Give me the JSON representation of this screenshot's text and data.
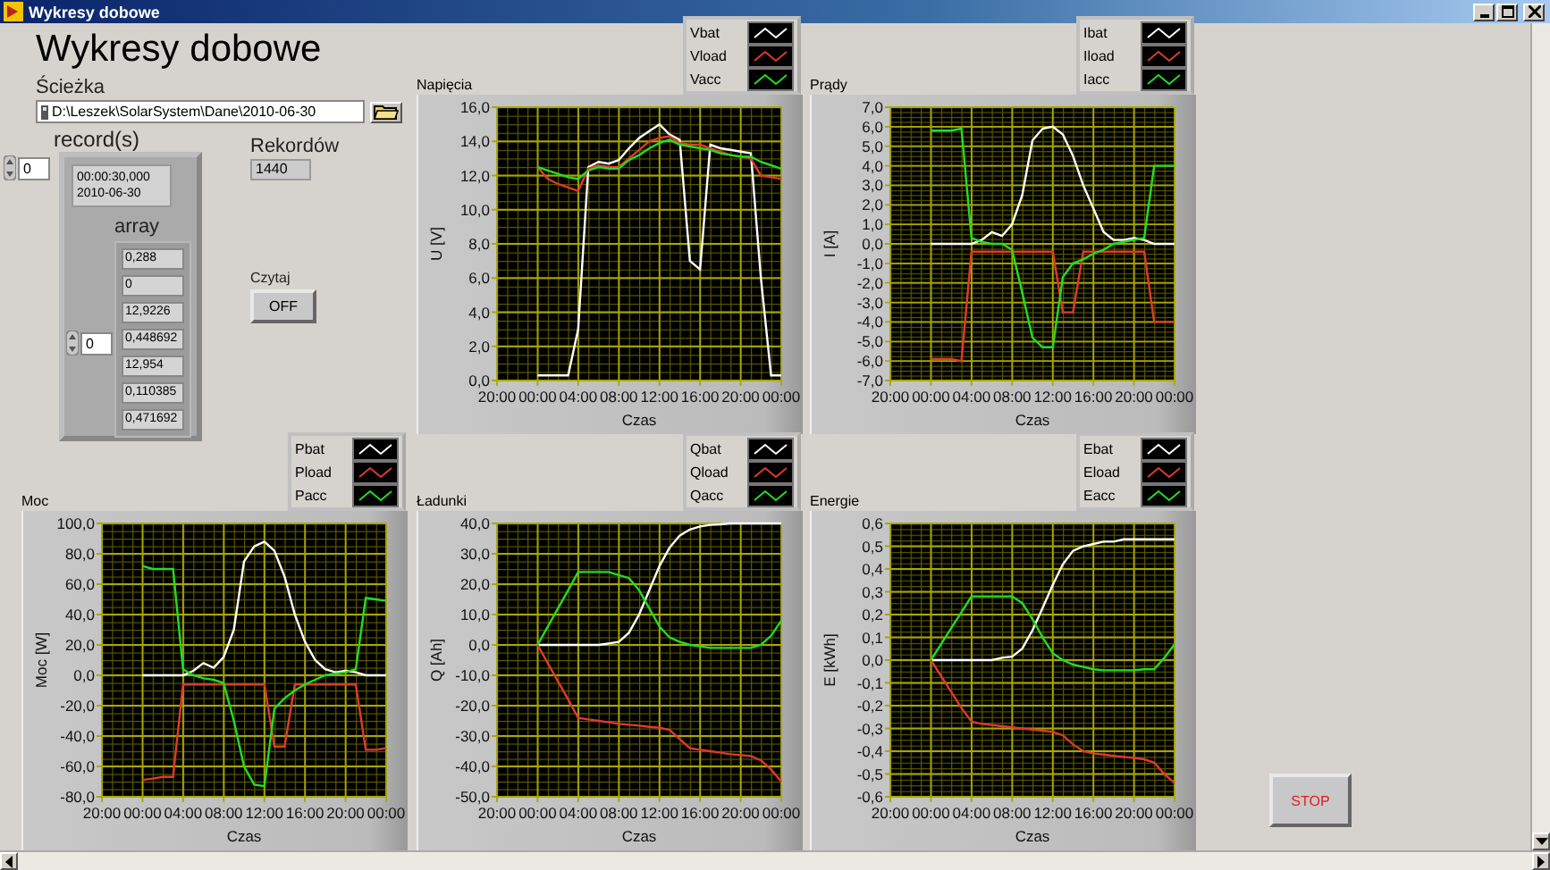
{
  "window": {
    "title": "Wykresy dobowe"
  },
  "heading": "Wykresy dobowe",
  "path": {
    "label": "Ścieżka",
    "value": "D:\\Leszek\\SolarSystem\\Dane\\2010-06-30"
  },
  "records": {
    "label": "record(s)",
    "index": "0",
    "time": "00:00:30,000",
    "date": "2010-06-30",
    "array_label": "array",
    "array_index": "0",
    "values": [
      "0,288",
      "0",
      "12,9226",
      "0,448692",
      "12,954",
      "0,110385",
      "0,471692"
    ]
  },
  "count": {
    "label": "Rekordów",
    "value": "1440"
  },
  "read_button": {
    "label": "Czytaj",
    "text": "OFF"
  },
  "charts": [
    {
      "title": "Napięcia",
      "chart_data": {
        "type": "line",
        "grid": true,
        "xlabel": "Czas",
        "ylabel": "U [V]",
        "x": [
          "2010-06-30T00:00",
          "2010-06-30T01:00",
          "2010-06-30T02:00",
          "2010-06-30T03:00",
          "2010-06-30T04:00",
          "2010-06-30T05:00",
          "2010-06-30T06:00",
          "2010-06-30T07:00",
          "2010-06-30T08:00",
          "2010-06-30T09:00",
          "2010-06-30T10:00",
          "2010-06-30T11:00",
          "2010-06-30T12:00",
          "2010-06-30T13:00",
          "2010-06-30T14:00",
          "2010-06-30T15:00",
          "2010-06-30T16:00",
          "2010-06-30T17:00",
          "2010-06-30T18:00",
          "2010-06-30T19:00",
          "2010-06-30T20:00",
          "2010-06-30T21:00",
          "2010-06-30T22:00",
          "2010-06-30T23:00",
          "2010-07-01T00:00"
        ],
        "xlim": [
          "2010-06-29T20:00",
          "2010-07-01T00:00"
        ],
        "ylim": [
          0,
          16
        ],
        "xticks": [
          {
            "value": "2010-06-29T20:00",
            "label": "20:00"
          },
          {
            "value": "2010-06-30T00:00",
            "label": "00:00"
          },
          {
            "value": "2010-06-30T04:00",
            "label": "04:00"
          },
          {
            "value": "2010-06-30T08:00",
            "label": "08:00"
          },
          {
            "value": "2010-06-30T12:00",
            "label": "12:00"
          },
          {
            "value": "2010-06-30T16:00",
            "label": "16:00"
          },
          {
            "value": "2010-06-30T20:00",
            "label": "20:00"
          },
          {
            "value": "2010-07-01T00:00",
            "label": "00:00"
          }
        ],
        "yticks": [
          {
            "value": 0,
            "label": "0,0"
          },
          {
            "value": 2,
            "label": "2,0"
          },
          {
            "value": 4,
            "label": "4,0"
          },
          {
            "value": 6,
            "label": "6,0"
          },
          {
            "value": 8,
            "label": "8,0"
          },
          {
            "value": 10,
            "label": "10,0"
          },
          {
            "value": 12,
            "label": "12,0"
          },
          {
            "value": 14,
            "label": "14,0"
          },
          {
            "value": 16,
            "label": "16,0"
          }
        ],
        "series": [
          {
            "name": "Vbat",
            "color": "#ffffff",
            "values": [
              0.3,
              0.3,
              0.3,
              0.3,
              3,
              12.5,
              12.8,
              12.7,
              12.9,
              13.6,
              14.2,
              14.6,
              15,
              14.4,
              14.1,
              7,
              6.5,
              13.8,
              13.6,
              13.5,
              13.4,
              13.3,
              6,
              0.3,
              0.3
            ]
          },
          {
            "name": "Vload",
            "color": "#e03a2a",
            "values": [
              12.5,
              11.8,
              11.5,
              11.3,
              11.1,
              12.4,
              12.6,
              12.5,
              12.5,
              13,
              13.5,
              14,
              14.2,
              14.3,
              13.9,
              13.8,
              13.8,
              13.6,
              13.4,
              13.2,
              13.1,
              13,
              12,
              11.9,
              11.8
            ]
          },
          {
            "name": "Vacc",
            "color": "#22dd22",
            "values": [
              12.5,
              12.3,
              12.1,
              11.9,
              11.8,
              12.3,
              12.5,
              12.4,
              12.4,
              12.9,
              13.2,
              13.6,
              13.9,
              14.1,
              13.8,
              13.7,
              13.6,
              13.5,
              13.3,
              13.2,
              13.1,
              13.1,
              12.8,
              12.6,
              12.4
            ]
          }
        ]
      }
    },
    {
      "title": "Prądy",
      "chart_data": {
        "type": "line",
        "grid": true,
        "xlabel": "Czas",
        "ylabel": "I [A]",
        "x": [
          "2010-06-30T00:00",
          "2010-06-30T01:00",
          "2010-06-30T02:00",
          "2010-06-30T03:00",
          "2010-06-30T04:00",
          "2010-06-30T05:00",
          "2010-06-30T06:00",
          "2010-06-30T07:00",
          "2010-06-30T08:00",
          "2010-06-30T09:00",
          "2010-06-30T10:00",
          "2010-06-30T11:00",
          "2010-06-30T12:00",
          "2010-06-30T13:00",
          "2010-06-30T14:00",
          "2010-06-30T15:00",
          "2010-06-30T16:00",
          "2010-06-30T17:00",
          "2010-06-30T18:00",
          "2010-06-30T19:00",
          "2010-06-30T20:00",
          "2010-06-30T21:00",
          "2010-06-30T22:00",
          "2010-06-30T23:00",
          "2010-07-01T00:00"
        ],
        "xlim": [
          "2010-06-29T20:00",
          "2010-07-01T00:00"
        ],
        "ylim": [
          -7,
          7
        ],
        "xticks": [
          {
            "value": "2010-06-29T20:00",
            "label": "20:00"
          },
          {
            "value": "2010-06-30T00:00",
            "label": "00:00"
          },
          {
            "value": "2010-06-30T04:00",
            "label": "04:00"
          },
          {
            "value": "2010-06-30T08:00",
            "label": "08:00"
          },
          {
            "value": "2010-06-30T12:00",
            "label": "12:00"
          },
          {
            "value": "2010-06-30T16:00",
            "label": "16:00"
          },
          {
            "value": "2010-06-30T20:00",
            "label": "20:00"
          },
          {
            "value": "2010-07-01T00:00",
            "label": "00:00"
          }
        ],
        "yticks": [
          {
            "value": -7,
            "label": "-7,0"
          },
          {
            "value": -6,
            "label": "-6,0"
          },
          {
            "value": -5,
            "label": "-5,0"
          },
          {
            "value": -4,
            "label": "-4,0"
          },
          {
            "value": -3,
            "label": "-3,0"
          },
          {
            "value": -2,
            "label": "-2,0"
          },
          {
            "value": -1,
            "label": "-1,0"
          },
          {
            "value": 0,
            "label": "0,0"
          },
          {
            "value": 1,
            "label": "1,0"
          },
          {
            "value": 2,
            "label": "2,0"
          },
          {
            "value": 3,
            "label": "3,0"
          },
          {
            "value": 4,
            "label": "4,0"
          },
          {
            "value": 5,
            "label": "5,0"
          },
          {
            "value": 6,
            "label": "6,0"
          },
          {
            "value": 7,
            "label": "7,0"
          }
        ],
        "series": [
          {
            "name": "Ibat",
            "color": "#ffffff",
            "values": [
              0,
              0,
              0,
              0,
              0,
              0.2,
              0.6,
              0.4,
              1,
              2.5,
              5.3,
              5.9,
              6,
              5.6,
              4.5,
              3,
              1.8,
              0.6,
              0.2,
              0.2,
              0.3,
              0.2,
              0,
              0,
              0
            ]
          },
          {
            "name": "Iload",
            "color": "#e03a2a",
            "values": [
              -5.9,
              -5.9,
              -5.9,
              -6,
              -0.4,
              -0.4,
              -0.4,
              -0.4,
              -0.4,
              -0.4,
              -0.4,
              -0.4,
              -0.4,
              -3.5,
              -3.5,
              -0.4,
              -0.4,
              -0.4,
              -0.4,
              -0.4,
              -0.4,
              -0.4,
              -4,
              -4,
              -4
            ]
          },
          {
            "name": "Iacc",
            "color": "#22dd22",
            "values": [
              5.8,
              5.8,
              5.8,
              5.9,
              0.3,
              0.1,
              0,
              0,
              -0.3,
              -2.5,
              -4.8,
              -5.3,
              -5.3,
              -1.7,
              -1,
              -0.8,
              -0.5,
              -0.3,
              0,
              0.1,
              0.2,
              0.3,
              4,
              4,
              4
            ]
          }
        ]
      }
    },
    {
      "title": "Moc",
      "chart_data": {
        "type": "line",
        "grid": true,
        "xlabel": "Czas",
        "ylabel": "Moc [W]",
        "x": [
          "2010-06-30T00:00",
          "2010-06-30T01:00",
          "2010-06-30T02:00",
          "2010-06-30T03:00",
          "2010-06-30T04:00",
          "2010-06-30T05:00",
          "2010-06-30T06:00",
          "2010-06-30T07:00",
          "2010-06-30T08:00",
          "2010-06-30T09:00",
          "2010-06-30T10:00",
          "2010-06-30T11:00",
          "2010-06-30T12:00",
          "2010-06-30T13:00",
          "2010-06-30T14:00",
          "2010-06-30T15:00",
          "2010-06-30T16:00",
          "2010-06-30T17:00",
          "2010-06-30T18:00",
          "2010-06-30T19:00",
          "2010-06-30T20:00",
          "2010-06-30T21:00",
          "2010-06-30T22:00",
          "2010-06-30T23:00",
          "2010-07-01T00:00"
        ],
        "xlim": [
          "2010-06-29T20:00",
          "2010-07-01T00:00"
        ],
        "ylim": [
          -80,
          100
        ],
        "xticks": [
          {
            "value": "2010-06-29T20:00",
            "label": "20:00"
          },
          {
            "value": "2010-06-30T00:00",
            "label": "00:00"
          },
          {
            "value": "2010-06-30T04:00",
            "label": "04:00"
          },
          {
            "value": "2010-06-30T08:00",
            "label": "08:00"
          },
          {
            "value": "2010-06-30T12:00",
            "label": "12:00"
          },
          {
            "value": "2010-06-30T16:00",
            "label": "16:00"
          },
          {
            "value": "2010-06-30T20:00",
            "label": "20:00"
          },
          {
            "value": "2010-07-01T00:00",
            "label": "00:00"
          }
        ],
        "yticks": [
          {
            "value": -80,
            "label": "-80,0"
          },
          {
            "value": -60,
            "label": "-60,0"
          },
          {
            "value": -40,
            "label": "-40,0"
          },
          {
            "value": -20,
            "label": "-20,0"
          },
          {
            "value": 0,
            "label": "0,0"
          },
          {
            "value": 20,
            "label": "20,0"
          },
          {
            "value": 40,
            "label": "40,0"
          },
          {
            "value": 60,
            "label": "60,0"
          },
          {
            "value": 80,
            "label": "80,0"
          },
          {
            "value": 100,
            "label": "100,0"
          }
        ],
        "series": [
          {
            "name": "Pbat",
            "color": "#ffffff",
            "values": [
              0,
              0,
              0,
              0,
              0,
              3,
              8,
              5,
              12,
              30,
              75,
              85,
              88,
              82,
              65,
              40,
              22,
              10,
              4,
              2,
              3,
              2,
              0,
              0,
              0
            ]
          },
          {
            "name": "Pload",
            "color": "#e03a2a",
            "values": [
              -69,
              -68,
              -67,
              -67,
              -6,
              -6,
              -6,
              -6,
              -6,
              -6,
              -6,
              -6,
              -6,
              -47,
              -47,
              -6,
              -6,
              -6,
              -6,
              -6,
              -6,
              -6,
              -49,
              -49,
              -48
            ]
          },
          {
            "name": "Pacc",
            "color": "#22dd22",
            "values": [
              72,
              70,
              70,
              70,
              4,
              0,
              -2,
              -3,
              -5,
              -30,
              -60,
              -72,
              -73,
              -22,
              -15,
              -10,
              -6,
              -3,
              0,
              1,
              2,
              4,
              51,
              50,
              49
            ]
          }
        ]
      }
    },
    {
      "title": "Ładunki",
      "chart_data": {
        "type": "line",
        "grid": true,
        "xlabel": "Czas",
        "ylabel": "Q [Ah]",
        "x": [
          "2010-06-30T00:00",
          "2010-06-30T01:00",
          "2010-06-30T02:00",
          "2010-06-30T03:00",
          "2010-06-30T04:00",
          "2010-06-30T05:00",
          "2010-06-30T06:00",
          "2010-06-30T07:00",
          "2010-06-30T08:00",
          "2010-06-30T09:00",
          "2010-06-30T10:00",
          "2010-06-30T11:00",
          "2010-06-30T12:00",
          "2010-06-30T13:00",
          "2010-06-30T14:00",
          "2010-06-30T15:00",
          "2010-06-30T16:00",
          "2010-06-30T17:00",
          "2010-06-30T18:00",
          "2010-06-30T19:00",
          "2010-06-30T20:00",
          "2010-06-30T21:00",
          "2010-06-30T22:00",
          "2010-06-30T23:00",
          "2010-07-01T00:00"
        ],
        "xlim": [
          "2010-06-29T20:00",
          "2010-07-01T00:00"
        ],
        "ylim": [
          -50,
          40
        ],
        "xticks": [
          {
            "value": "2010-06-29T20:00",
            "label": "20:00"
          },
          {
            "value": "2010-06-30T00:00",
            "label": "00:00"
          },
          {
            "value": "2010-06-30T04:00",
            "label": "04:00"
          },
          {
            "value": "2010-06-30T08:00",
            "label": "08:00"
          },
          {
            "value": "2010-06-30T12:00",
            "label": "12:00"
          },
          {
            "value": "2010-06-30T16:00",
            "label": "16:00"
          },
          {
            "value": "2010-06-30T20:00",
            "label": "20:00"
          },
          {
            "value": "2010-07-01T00:00",
            "label": "00:00"
          }
        ],
        "yticks": [
          {
            "value": -50,
            "label": "-50,0"
          },
          {
            "value": -40,
            "label": "-40,0"
          },
          {
            "value": -30,
            "label": "-30,0"
          },
          {
            "value": -20,
            "label": "-20,0"
          },
          {
            "value": -10,
            "label": "-10,0"
          },
          {
            "value": 0,
            "label": "0,0"
          },
          {
            "value": 10,
            "label": "10,0"
          },
          {
            "value": 20,
            "label": "20,0"
          },
          {
            "value": 30,
            "label": "30,0"
          },
          {
            "value": 40,
            "label": "40,0"
          }
        ],
        "series": [
          {
            "name": "Qbat",
            "color": "#ffffff",
            "values": [
              0,
              0,
              0,
              0,
              0,
              0,
              0,
              0.5,
              1,
              4,
              10,
              18,
              26,
              32,
              36,
              38,
              39,
              39.5,
              39.7,
              40,
              40,
              40,
              40,
              40,
              40
            ]
          },
          {
            "name": "Qload",
            "color": "#e03a2a",
            "values": [
              0,
              -6,
              -12,
              -18,
              -24,
              -24.5,
              -25,
              -25.5,
              -26,
              -26.3,
              -26.6,
              -27,
              -27.3,
              -28,
              -31,
              -34,
              -34.5,
              -35,
              -35.5,
              -36,
              -36.3,
              -36.6,
              -38,
              -41,
              -45
            ]
          },
          {
            "name": "Qacc",
            "color": "#22dd22",
            "values": [
              0,
              6,
              12,
              18,
              24,
              24,
              24,
              24,
              23,
              22,
              18,
              12,
              6,
              2.5,
              1,
              0,
              -0.5,
              -1,
              -1,
              -1,
              -1,
              -1,
              0,
              3,
              8
            ]
          }
        ]
      }
    },
    {
      "title": "Energie",
      "chart_data": {
        "type": "line",
        "grid": true,
        "xlabel": "Czas",
        "ylabel": "E [kWh]",
        "x": [
          "2010-06-30T00:00",
          "2010-06-30T01:00",
          "2010-06-30T02:00",
          "2010-06-30T03:00",
          "2010-06-30T04:00",
          "2010-06-30T05:00",
          "2010-06-30T06:00",
          "2010-06-30T07:00",
          "2010-06-30T08:00",
          "2010-06-30T09:00",
          "2010-06-30T10:00",
          "2010-06-30T11:00",
          "2010-06-30T12:00",
          "2010-06-30T13:00",
          "2010-06-30T14:00",
          "2010-06-30T15:00",
          "2010-06-30T16:00",
          "2010-06-30T17:00",
          "2010-06-30T18:00",
          "2010-06-30T19:00",
          "2010-06-30T20:00",
          "2010-06-30T21:00",
          "2010-06-30T22:00",
          "2010-06-30T23:00",
          "2010-07-01T00:00"
        ],
        "xlim": [
          "2010-06-29T20:00",
          "2010-07-01T00:00"
        ],
        "ylim": [
          -0.6,
          0.6
        ],
        "xticks": [
          {
            "value": "2010-06-29T20:00",
            "label": "20:00"
          },
          {
            "value": "2010-06-30T00:00",
            "label": "00:00"
          },
          {
            "value": "2010-06-30T04:00",
            "label": "04:00"
          },
          {
            "value": "2010-06-30T08:00",
            "label": "08:00"
          },
          {
            "value": "2010-06-30T12:00",
            "label": "12:00"
          },
          {
            "value": "2010-06-30T16:00",
            "label": "16:00"
          },
          {
            "value": "2010-06-30T20:00",
            "label": "20:00"
          },
          {
            "value": "2010-07-01T00:00",
            "label": "00:00"
          }
        ],
        "yticks": [
          {
            "value": -0.6,
            "label": "-0,6"
          },
          {
            "value": -0.5,
            "label": "-0,5"
          },
          {
            "value": -0.4,
            "label": "-0,4"
          },
          {
            "value": -0.3,
            "label": "-0,3"
          },
          {
            "value": -0.2,
            "label": "-0,2"
          },
          {
            "value": -0.1,
            "label": "-0,1"
          },
          {
            "value": 0,
            "label": "0,0"
          },
          {
            "value": 0.1,
            "label": "0,1"
          },
          {
            "value": 0.2,
            "label": "0,2"
          },
          {
            "value": 0.3,
            "label": "0,3"
          },
          {
            "value": 0.4,
            "label": "0,4"
          },
          {
            "value": 0.5,
            "label": "0,5"
          },
          {
            "value": 0.6,
            "label": "0,6"
          }
        ],
        "series": [
          {
            "name": "Ebat",
            "color": "#ffffff",
            "values": [
              0,
              0,
              0,
              0,
              0,
              0,
              0,
              0.01,
              0.015,
              0.05,
              0.13,
              0.23,
              0.33,
              0.42,
              0.48,
              0.5,
              0.51,
              0.52,
              0.52,
              0.53,
              0.53,
              0.53,
              0.53,
              0.53,
              0.53
            ]
          },
          {
            "name": "Eload",
            "color": "#e03a2a",
            "values": [
              0,
              -0.07,
              -0.14,
              -0.21,
              -0.27,
              -0.28,
              -0.285,
              -0.29,
              -0.295,
              -0.3,
              -0.305,
              -0.31,
              -0.315,
              -0.33,
              -0.37,
              -0.4,
              -0.41,
              -0.415,
              -0.42,
              -0.425,
              -0.43,
              -0.435,
              -0.45,
              -0.5,
              -0.54
            ]
          },
          {
            "name": "Eacc",
            "color": "#22dd22",
            "values": [
              0,
              0.07,
              0.14,
              0.21,
              0.28,
              0.28,
              0.28,
              0.28,
              0.28,
              0.25,
              0.18,
              0.1,
              0.03,
              0,
              -0.02,
              -0.03,
              -0.04,
              -0.045,
              -0.045,
              -0.045,
              -0.045,
              -0.04,
              -0.04,
              0.01,
              0.07
            ]
          }
        ]
      }
    }
  ],
  "stop_button": "STOP"
}
